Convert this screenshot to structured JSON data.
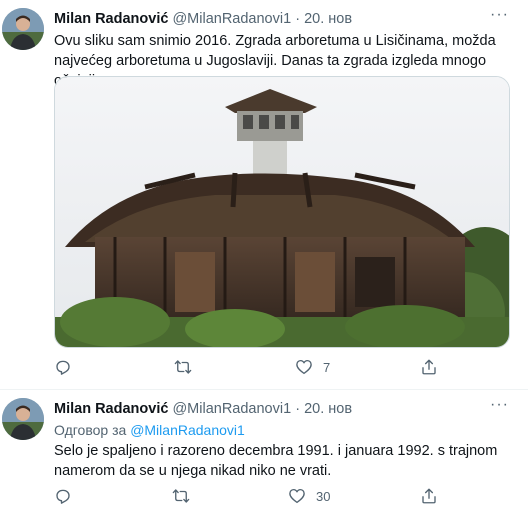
{
  "tweets": [
    {
      "author_name": "Milan Radanović",
      "handle": "@MilanRadanovi1",
      "separator": "·",
      "date": "20. нов",
      "text": "Ovu sliku sam snimio 2016. Zgrada arboretuma u Lisičinama, možda najvećeg arboretuma u Jugoslaviji. Danas ta zgrada izgleda mnogo očajnije.",
      "icons": {
        "avatar": "avatar",
        "more": "more-icon",
        "reply": "reply-icon",
        "retweet": "retweet-icon",
        "like": "like-icon",
        "share": "share-icon"
      },
      "likes": "7"
    },
    {
      "author_name": "Milan Radanović",
      "handle": "@MilanRadanovi1",
      "separator": "·",
      "date": "20. нов",
      "reply_prefix": "Одговор за",
      "reply_to": "@MilanRadanovi1",
      "text": "Selo je spaljeno i razoreno decembra 1991. i januara 1992. s trajnom namerom da se u njega nikad niko ne vrati.",
      "icons": {
        "avatar": "avatar",
        "more": "more-icon",
        "reply": "reply-icon",
        "retweet": "retweet-icon",
        "like": "like-icon",
        "share": "share-icon"
      },
      "likes": "30"
    }
  ],
  "colors": {
    "accent": "#1d9bf0",
    "muted": "#536471",
    "text": "#0f1419",
    "divider": "#eff3f4"
  }
}
